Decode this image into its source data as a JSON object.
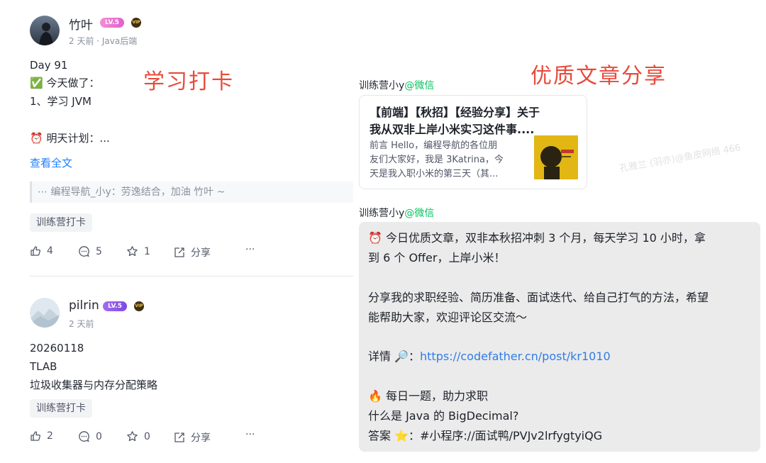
{
  "posts": [
    {
      "author": "竹叶",
      "level_badge": "LV.5",
      "vip_badge": "VIP",
      "meta": "2 天前 · Java后端",
      "lines": [
        "Day 91",
        "✅ 今天做了：",
        "1、学习 JVM",
        "⏰ 明天计划：..."
      ],
      "read_more": "查看全文",
      "comment": "⋯ 编程导航_小y：劳逸结合，加油 竹叶 ~",
      "tag": "训练营打卡",
      "actions": {
        "likes": "4",
        "comments": "5",
        "stars": "1",
        "share": "分享",
        "more": "···"
      }
    },
    {
      "author": "pilrin",
      "level_badge": "LV.5",
      "vip_badge": "VIP",
      "meta": "2 天前",
      "lines": [
        "20260118",
        "TLAB",
        "垃圾收集器与内存分配策略"
      ],
      "tag": "训练营打卡",
      "actions": {
        "likes": "2",
        "comments": "0",
        "stars": "0",
        "share": "分享",
        "more": "···"
      }
    }
  ],
  "labels": {
    "study_checkin": "学习打卡",
    "quality_share": "优质文章分享"
  },
  "source": {
    "name": "训练营小y",
    "suffix": "@微信"
  },
  "article_card": {
    "title_lines": [
      "【前端】【秋招】【经验分享】关于",
      "我从双非上岸小米实习这件事...."
    ],
    "desc_lines": [
      "前言 Hello，编程导航的各位朋",
      "友们大家好，我是 3Katrina，今",
      "天是我入职小米的第三天（其..."
    ]
  },
  "message": {
    "lines": [
      "⏰ 今日优质文章，双非本秋招冲刺 3 个月，每天学习 10 小时，拿",
      "到 6 个 Offer，上岸小米！",
      "分享我的求职经验、简历准备、面试迭代、给自己打气的方法，希望",
      "能帮助大家，欢迎评论区交流～"
    ],
    "detail_label": "详情 🔎：",
    "detail_link": "https://codefather.cn/post/kr1010",
    "tail_lines": [
      "🔥 每日一题，助力求职",
      "什么是 Java 的 BigDecimal?",
      "答案 ⭐️：#小程序://面试鸭/PVJv2lrfygtyiQG"
    ]
  },
  "watermark": "孔雅兰 (羽亦)@鱼皮网络 466",
  "colors": {
    "accent_red": "#e84a3b",
    "wechat_green": "#07c160",
    "link_blue": "#2f7ce8"
  }
}
